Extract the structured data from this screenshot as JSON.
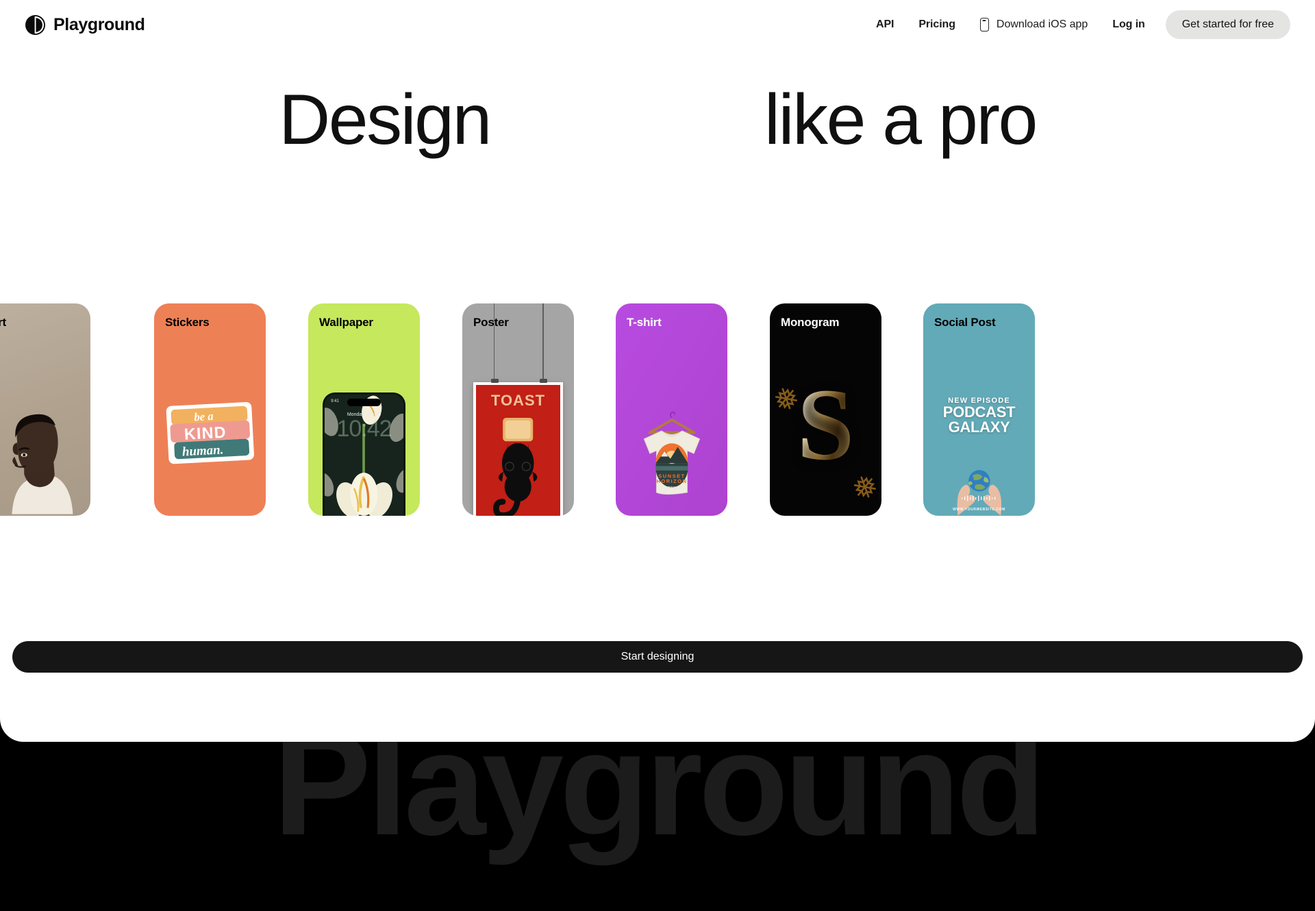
{
  "brand": {
    "name": "Playground",
    "logo_icon": "playground-circle-logo"
  },
  "nav": {
    "links": [
      {
        "label": "API",
        "name": "api"
      },
      {
        "label": "Pricing",
        "name": "pricing"
      }
    ],
    "ios": {
      "label": "Download iOS app",
      "icon": "phone-icon"
    },
    "login_label": "Log in",
    "cta_label": "Get started for free",
    "cta_bg": "#e4e4e2"
  },
  "hero": {
    "line_left": "Design",
    "line_right": "like a pro"
  },
  "cards": [
    {
      "label": "Art",
      "bg": "#b0a18e",
      "label_color": "#111111",
      "art": "portrait-photo"
    },
    {
      "label": "Stickers",
      "bg": "#ee8056",
      "label_color": "#111111",
      "art": "sticker-lettering",
      "sticker_lines": [
        "be a",
        "KIND",
        "human."
      ]
    },
    {
      "label": "Wallpaper",
      "bg": "#c5e85c",
      "label_color": "#111111",
      "art": "phone-lockscreen-tulip",
      "phone": {
        "status_time": "9:41",
        "date": "Monday, June 5",
        "clock": "10:42"
      }
    },
    {
      "label": "Poster",
      "bg": "#a5a5a5",
      "label_color": "#111111",
      "art": "hanging-toast-poster",
      "poster_title": "TOAST"
    },
    {
      "label": "T-shirt",
      "bg": "#b347d6",
      "label_color": "#ffffff",
      "art": "tshirt-on-hanger",
      "tee_print": [
        "SUNSET",
        "HORIZON"
      ]
    },
    {
      "label": "Monogram",
      "bg": "#000000",
      "label_color": "#ffffff",
      "art": "gold-ornate-letter",
      "letter": "S"
    },
    {
      "label": "Social Post",
      "bg": "#62aab8",
      "label_color": "#111111",
      "art": "podcast-globe-hands",
      "post": {
        "kicker": "NEW EPISODE",
        "title_1": "PODCAST",
        "title_2": "GALAXY",
        "url": "WWW.YOURWEBSITE.COM"
      }
    }
  ],
  "start_button": {
    "label": "Start designing",
    "bg": "#161616"
  },
  "marquee": {
    "text": "Playground"
  }
}
